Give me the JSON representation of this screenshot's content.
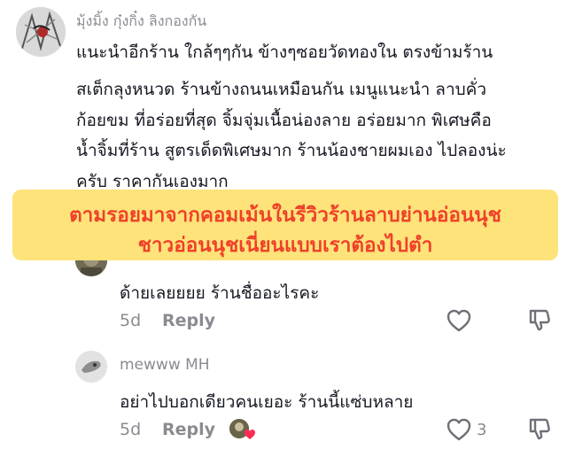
{
  "comments": [
    {
      "username": "มุ้งมิ้ง กุ๋งกิ๋ง ลิงกองกัน",
      "lines": [
        "แนะนำอีกร้าน ใกล้ๆๆกัน ข้างๆซอยวัดทองใน ตรงข้ามร้าน",
        "สเต็กลุงหนวด ร้านข้างถนนเหมือนกัน เมนูแนะนำ ลาบคั่ว",
        "ก้อยขม ที่อร่อยที่สุด จิ้มจุ่มเนื้อน่องลาย อร่อยมาก พิเศษคือ",
        "น้ำจิ้มที่ร้าน สูตรเด็ดพิเศษมาก ร้านน้องชายผมเอง ไปลองน่ะ",
        "ครับ ราคากันเองมาก"
      ]
    },
    {
      "username": "",
      "lines": [
        "ด้ายเลยยยย ร้านชื่ออะไรคะ"
      ],
      "time": "5d",
      "reply": "Reply"
    },
    {
      "username": "mewww MH",
      "lines": [
        "อย่าไปบอกเดียวคนเยอะ ร้านนี้แซ่บหลาย"
      ],
      "time": "5d",
      "reply": "Reply",
      "likes": "3"
    }
  ],
  "banner": {
    "line1": "ตามรอยมาจากคอมเม้นในรีวิวร้านลาบย่านอ่อนนุช",
    "line2": "ชาวอ่อนนุชเนี่ยนแบบเราต้องไปตำ"
  },
  "colors": {
    "banner_bg": "#fde37a",
    "banner_text": "#f0402a",
    "like_heart": "#fe2c55"
  },
  "icons": [
    "heart-outline-icon",
    "dislike-icon",
    "liked-by-creator-icon"
  ]
}
